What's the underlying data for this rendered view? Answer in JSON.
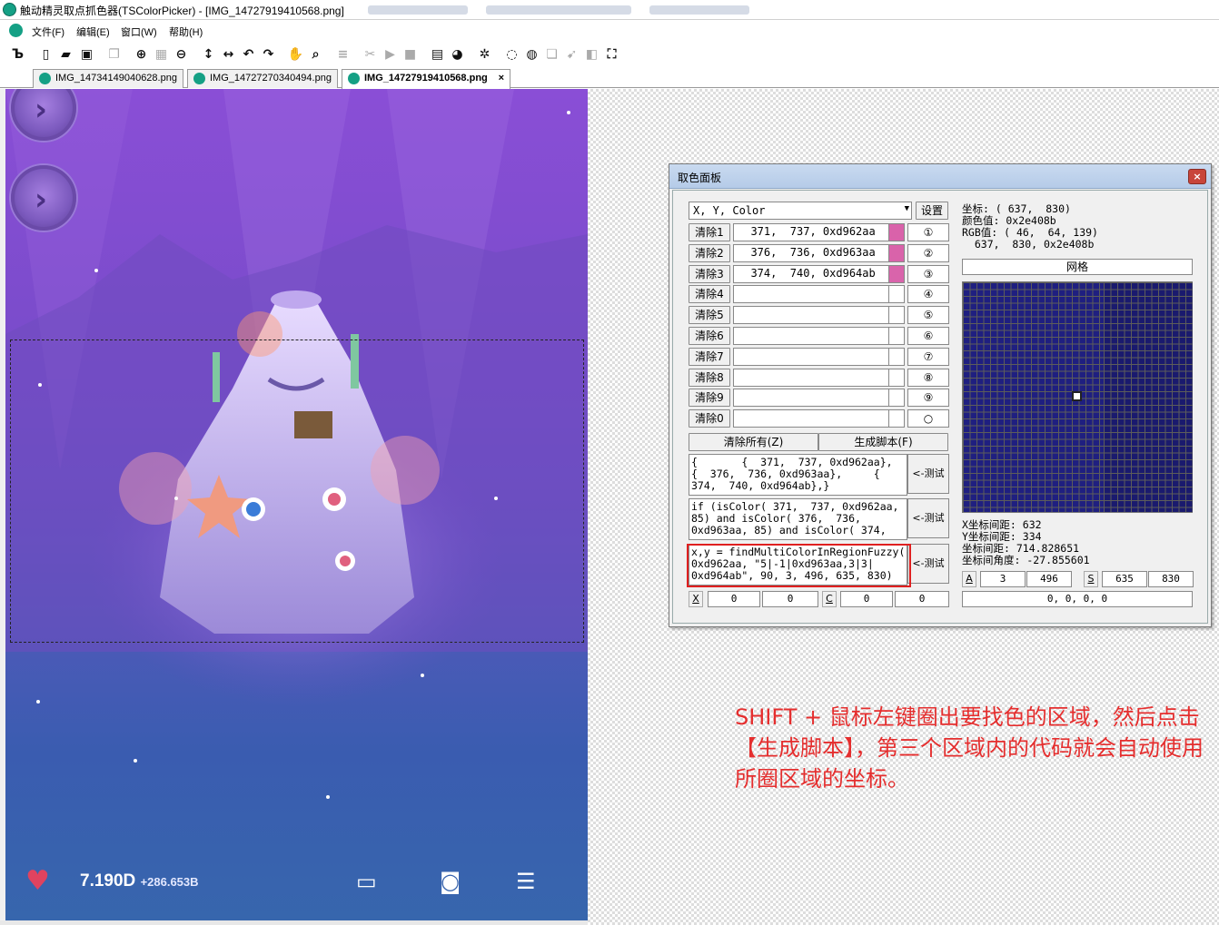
{
  "window": {
    "title": "触动精灵取点抓色器(TSColorPicker) - [IMG_14727919410568.png]"
  },
  "menu": [
    "文件(F)",
    "编辑(E)",
    "窗口(W)",
    "帮助(H)"
  ],
  "tabs": [
    "IMG_14734149040628.png",
    "IMG_14727270340494.png",
    "IMG_14727919410568.png"
  ],
  "tab_close": "×",
  "game": {
    "money": "7.190D",
    "rate": "+286.653B"
  },
  "panel": {
    "title": "取色面板",
    "close": "×",
    "mode_select": "X, Y, Color",
    "settings_btn": "设置",
    "rows": [
      {
        "clear": "清除1",
        "value": "  371,  737, 0xd962aa",
        "color": "#d962aa",
        "num": "①"
      },
      {
        "clear": "清除2",
        "value": "  376,  736, 0xd963aa",
        "color": "#d963aa",
        "num": "②"
      },
      {
        "clear": "清除3",
        "value": "  374,  740, 0xd964ab",
        "color": "#d964ab",
        "num": "③"
      },
      {
        "clear": "清除4",
        "value": "",
        "color": "#ffffff",
        "num": "④"
      },
      {
        "clear": "清除5",
        "value": "",
        "color": "#ffffff",
        "num": "⑤"
      },
      {
        "clear": "清除6",
        "value": "",
        "color": "#ffffff",
        "num": "⑥"
      },
      {
        "clear": "清除7",
        "value": "",
        "color": "#ffffff",
        "num": "⑦"
      },
      {
        "clear": "清除8",
        "value": "",
        "color": "#ffffff",
        "num": "⑧"
      },
      {
        "clear": "清除9",
        "value": "",
        "color": "#ffffff",
        "num": "⑨"
      },
      {
        "clear": "清除0",
        "value": "",
        "color": "#ffffff",
        "num": "○"
      }
    ],
    "clear_all": "清除所有(Z)",
    "gen_script": "生成脚本(F)",
    "code1": "{       {  371,  737, 0xd962aa},\n{  376,  736, 0xd963aa},     {\n374,  740, 0xd964ab},}",
    "code2": "if (isColor( 371,  737, 0xd962aa,\n85) and isColor( 376,  736,\n0xd963aa, 85) and isColor( 374,",
    "code3": "x,y = findMultiColorInRegionFuzzy(\n0xd962aa, \"5|-1|0xd963aa,3|3|\n0xd964ab\", 90, 3, 496, 635, 830)",
    "test_btn": "<-测试",
    "info": "坐标: ( 637,  830)\n颜色值: 0x2e408b\nRGB值: ( 46,  64, 139)\n  637,  830, 0x2e408b",
    "grid_label": "网格",
    "dist": "X坐标间距: 632\nY坐标间距: 334\n坐标间距: 714.828651\n坐标间角度: -27.855601",
    "a_label": "A",
    "a_vals": [
      "3",
      "496"
    ],
    "s_label": "S",
    "s_vals": [
      "635",
      "830"
    ],
    "x_label": "X",
    "x_vals": [
      "0",
      "0"
    ],
    "c_label": "C",
    "c_vals": [
      "0",
      "0"
    ],
    "zeros": "0, 0, 0, 0"
  },
  "note": "SHIFT + 鼠标左键圈出要找色的区域，然后点击【生成脚本】，第三个区域内的代码就会自动使用所圈区域的坐标。"
}
